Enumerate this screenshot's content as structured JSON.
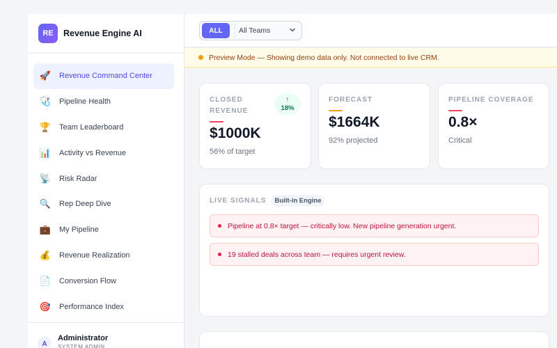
{
  "brand": {
    "logo": "RE",
    "name": "Revenue Engine AI"
  },
  "nav": [
    {
      "label": "Revenue Command Center",
      "icon": "🚀",
      "active": true
    },
    {
      "label": "Pipeline Health",
      "icon": "🩺"
    },
    {
      "label": "Team Leaderboard",
      "icon": "🏆"
    },
    {
      "label": "Activity vs Revenue",
      "icon": "📊"
    },
    {
      "label": "Risk Radar",
      "icon": "📡"
    },
    {
      "label": "Rep Deep Dive",
      "icon": "🔍"
    },
    {
      "label": "My Pipeline",
      "icon": "💼"
    },
    {
      "label": "Revenue Realization",
      "icon": "💰"
    },
    {
      "label": "Conversion Flow",
      "icon": "📄"
    },
    {
      "label": "Performance Index",
      "icon": "🎯"
    }
  ],
  "user": {
    "initial": "A",
    "name": "Administrator",
    "role": "SYSTEM ADMIN"
  },
  "filter": {
    "all_label": "ALL",
    "team_value": "All Teams"
  },
  "banner": {
    "text": "Preview Mode — Showing demo data only. Not connected to live CRM."
  },
  "kpis": {
    "closed": {
      "label": "CLOSED REVENUE",
      "value": "$1000K",
      "sub": "56% of target",
      "trend_arrow": "↑",
      "trend_value": "18%",
      "accent": "#f43f5e"
    },
    "forecast": {
      "label": "FORECAST",
      "value": "$1664K",
      "sub": "92% projected",
      "accent": "#f59e0b"
    },
    "coverage": {
      "label": "PIPELINE COVERAGE",
      "value": "0.8×",
      "sub": "Critical",
      "accent": "#f43f5e"
    }
  },
  "signals": {
    "title": "LIVE SIGNALS",
    "badge": "Built-in Engine",
    "items": [
      "Pipeline at 0.8× target — critically low. New pipeline generation urgent.",
      "19 stalled deals across team — requires urgent review."
    ]
  }
}
